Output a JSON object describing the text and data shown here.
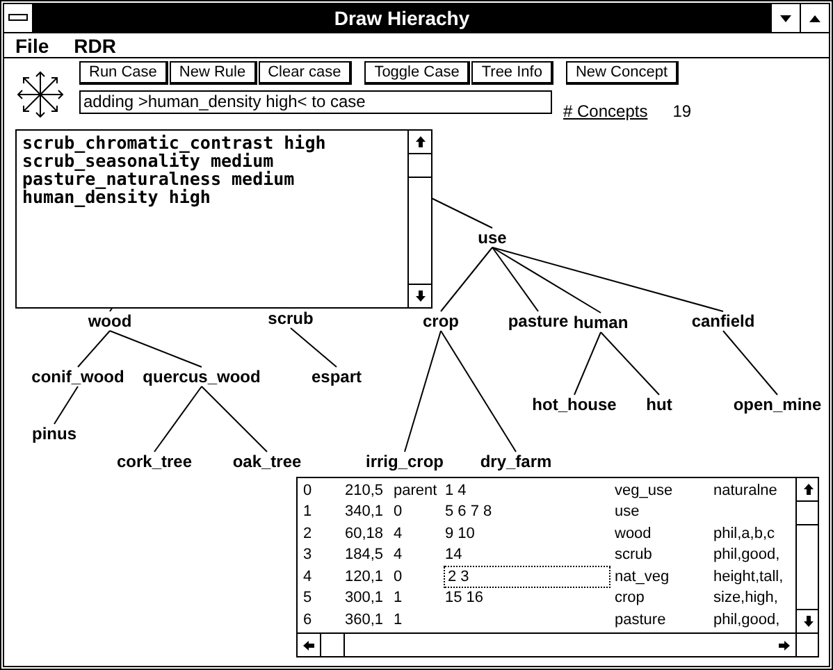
{
  "window": {
    "title": "Draw Hierachy"
  },
  "menu": [
    "File",
    "RDR"
  ],
  "toolbar": {
    "buttons": [
      [
        "Run Case",
        "New Rule",
        "Clear case"
      ],
      [
        "Toggle Case",
        "Tree Info"
      ],
      [
        "New Concept"
      ]
    ],
    "status": "adding >human_density high< to case",
    "concepts_label": "# Concepts",
    "concepts_count": "19"
  },
  "case_text": [
    "scrub_chromatic_contrast high",
    "scrub_seasonality medium",
    "pasture_naturalness medium",
    "human_density high"
  ],
  "tree": [
    {
      "label": "wood",
      "children": [
        {
          "label": "conif_wood",
          "children": [
            {
              "label": "pinus"
            }
          ]
        },
        {
          "label": "quercus_wood",
          "children": [
            {
              "label": "cork_tree"
            },
            {
              "label": "oak_tree"
            }
          ]
        }
      ]
    },
    {
      "label": "scrub",
      "children": [
        {
          "label": "espart"
        }
      ]
    },
    {
      "label": "use",
      "children": [
        {
          "label": "crop",
          "children": [
            {
              "label": "irrig_crop"
            },
            {
              "label": "dry_farm"
            }
          ]
        },
        {
          "label": "pasture"
        },
        {
          "label": "human",
          "children": [
            {
              "label": "hot_house"
            },
            {
              "label": "hut"
            }
          ]
        },
        {
          "label": "canfield",
          "children": [
            {
              "label": "open_mine"
            }
          ]
        }
      ]
    }
  ],
  "table": {
    "rows": [
      {
        "cells": [
          "0",
          "210,5",
          "parent",
          "1  4",
          "veg_use",
          "naturalne"
        ],
        "focused": false
      },
      {
        "cells": [
          "1",
          "340,1",
          "0",
          "5  6  7  8",
          "use",
          ""
        ],
        "focused": false
      },
      {
        "cells": [
          "2",
          "60,18",
          "4",
          "9  10",
          "wood",
          "phil,a,b,c"
        ],
        "focused": false
      },
      {
        "cells": [
          "3",
          "184,5",
          "4",
          "14",
          "scrub",
          "phil,good,"
        ],
        "focused": false
      },
      {
        "cells": [
          "4",
          "120,1",
          "0",
          "2  3",
          "nat_veg",
          "height,tall,"
        ],
        "focused": true
      },
      {
        "cells": [
          "5",
          "300,1",
          "1",
          "15  16",
          "crop",
          "size,high,"
        ],
        "focused": false
      },
      {
        "cells": [
          "6",
          "360,1",
          "1",
          "",
          "pasture",
          "phil,good,"
        ],
        "focused": false
      }
    ]
  }
}
